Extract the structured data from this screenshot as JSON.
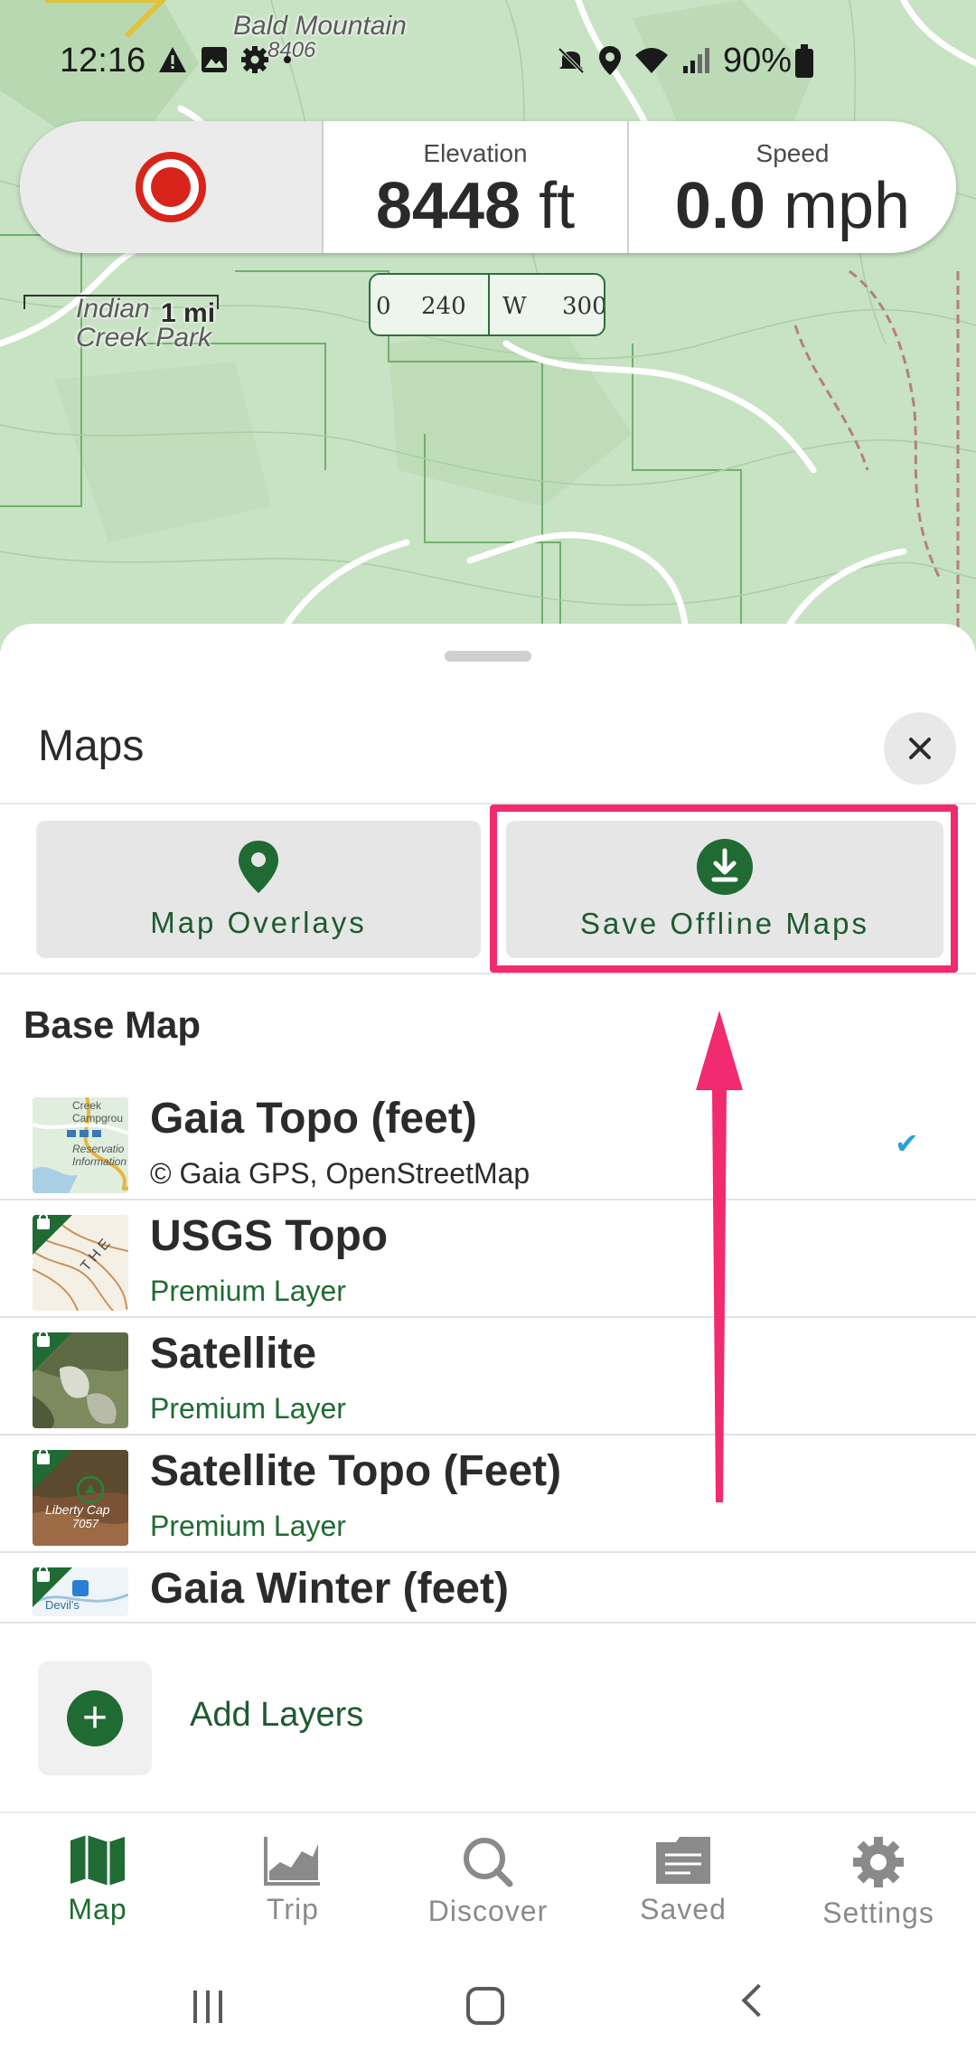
{
  "status_bar": {
    "time": "12:16",
    "battery": "90%",
    "left_icons": [
      "warning-icon",
      "image-icon",
      "gear-icon",
      "dot-icon"
    ],
    "right_icons": [
      "mute-icon",
      "location-icon",
      "wifi-icon",
      "signal-icon",
      "battery-icon"
    ]
  },
  "map": {
    "labels": {
      "peak_name": "Bald Mountain",
      "peak_elevation": "8406",
      "park_name": "Indian Creek Park"
    },
    "scale": "1 mi",
    "compass": {
      "left": "0",
      "mid_left": "240",
      "dir": "W",
      "right": "300"
    }
  },
  "stats": {
    "elevation_label": "Elevation",
    "elevation_value": "8448",
    "elevation_unit": "ft",
    "speed_label": "Speed",
    "speed_value": "0.0",
    "speed_unit": "mph"
  },
  "sheet": {
    "title": "Maps",
    "overlays_label": "Map Overlays",
    "offline_label": "Save Offline Maps",
    "section_title": "Base Map",
    "layers": [
      {
        "name": "Gaia Topo (feet)",
        "sub": "© Gaia GPS, OpenStreetMap",
        "premium": false,
        "selected": true
      },
      {
        "name": "USGS Topo",
        "sub": "Premium Layer",
        "premium": true,
        "selected": false
      },
      {
        "name": "Satellite",
        "sub": "Premium Layer",
        "premium": true,
        "selected": false
      },
      {
        "name": "Satellite Topo (Feet)",
        "sub": "Premium Layer",
        "premium": true,
        "selected": false
      },
      {
        "name": "Gaia Winter (feet)",
        "sub": "Premium Layer",
        "premium": true,
        "selected": false
      }
    ],
    "thumb_labels": {
      "gaia_1": "Creek",
      "gaia_2": "Campgrou",
      "gaia_3": "Reservatio",
      "gaia_4": "Information",
      "usgs": "T H E",
      "sat_topo_1": "Liberty Cap",
      "sat_topo_2": "7057",
      "winter": "Devil's"
    },
    "add_layers_label": "Add Layers"
  },
  "nav": {
    "items": [
      {
        "label": "Map",
        "icon": "map-icon",
        "active": true
      },
      {
        "label": "Trip",
        "icon": "chart-icon",
        "active": false
      },
      {
        "label": "Discover",
        "icon": "search-icon",
        "active": false
      },
      {
        "label": "Saved",
        "icon": "folder-icon",
        "active": false
      },
      {
        "label": "Settings",
        "icon": "gear-icon",
        "active": false
      }
    ]
  },
  "colors": {
    "brand_green": "#1f6b33",
    "record_red": "#d8241a",
    "highlight_pink": "#f22a6f",
    "map_green": "#c9e3c6",
    "check_blue": "#2a9fd8"
  }
}
